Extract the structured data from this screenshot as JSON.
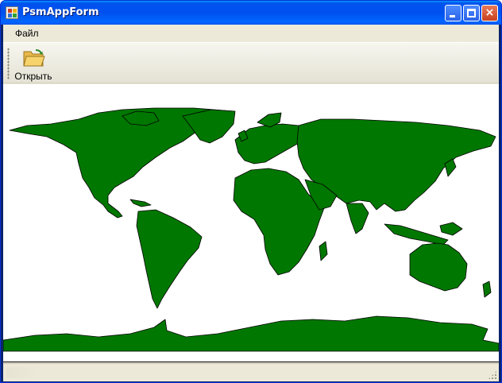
{
  "window": {
    "title": "PsmAppForm",
    "controls": {
      "minimize": "minimize",
      "maximize": "maximize",
      "close": "×"
    }
  },
  "menu": {
    "items": [
      {
        "label": "Файл"
      }
    ]
  },
  "toolbar": {
    "open_label": "Открыть",
    "open_icon": "folder-open-icon"
  },
  "map": {
    "land_color": "#007700",
    "border_color": "#000000",
    "background": "#ffffff"
  },
  "statusbar": {
    "text": ""
  }
}
